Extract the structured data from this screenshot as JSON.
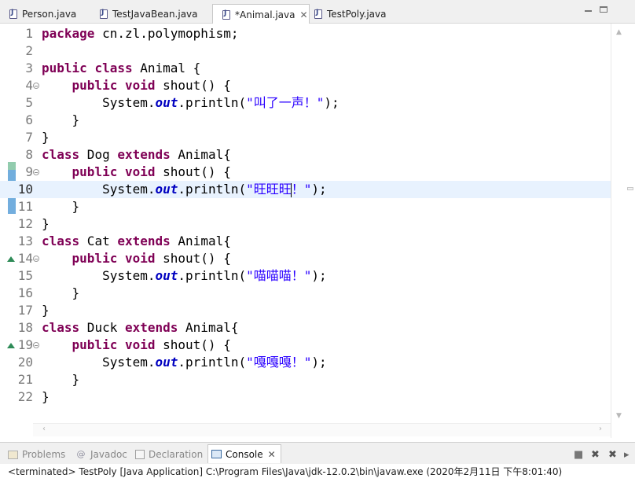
{
  "editor_tabs": [
    {
      "label": "Person.java",
      "active": false
    },
    {
      "label": "TestJavaBean.java",
      "active": false
    },
    {
      "label": "*Animal.java",
      "active": true,
      "close": "✕"
    },
    {
      "label": "TestPoly.java",
      "active": false
    }
  ],
  "code_lines": [
    {
      "num": "1",
      "segments": [
        {
          "t": "package",
          "c": "kw"
        },
        {
          "t": " cn.zl.polymophism;",
          "c": ""
        }
      ]
    },
    {
      "num": "2",
      "segments": []
    },
    {
      "num": "3",
      "segments": [
        {
          "t": "public",
          "c": "kw"
        },
        {
          "t": " ",
          "c": ""
        },
        {
          "t": "class",
          "c": "kw"
        },
        {
          "t": " Animal {",
          "c": ""
        }
      ]
    },
    {
      "num": "4",
      "fold": true,
      "segments": [
        {
          "t": "    ",
          "c": ""
        },
        {
          "t": "public",
          "c": "kw"
        },
        {
          "t": " ",
          "c": ""
        },
        {
          "t": "void",
          "c": "kw"
        },
        {
          "t": " shout() {",
          "c": ""
        }
      ]
    },
    {
      "num": "5",
      "segments": [
        {
          "t": "        System.",
          "c": ""
        },
        {
          "t": "out",
          "c": "fld"
        },
        {
          "t": ".println(",
          "c": ""
        },
        {
          "t": "\"叫了一声！\"",
          "c": "str"
        },
        {
          "t": ");",
          "c": ""
        }
      ]
    },
    {
      "num": "6",
      "segments": [
        {
          "t": "    }",
          "c": ""
        }
      ]
    },
    {
      "num": "7",
      "segments": [
        {
          "t": "}",
          "c": ""
        }
      ]
    },
    {
      "num": "8",
      "segments": [
        {
          "t": "class",
          "c": "kw"
        },
        {
          "t": " Dog ",
          "c": ""
        },
        {
          "t": "extends",
          "c": "kw"
        },
        {
          "t": " Animal{",
          "c": ""
        }
      ]
    },
    {
      "num": "9",
      "fold": true,
      "segments": [
        {
          "t": "    ",
          "c": ""
        },
        {
          "t": "public",
          "c": "kw"
        },
        {
          "t": " ",
          "c": ""
        },
        {
          "t": "void",
          "c": "kw"
        },
        {
          "t": " shout() {",
          "c": ""
        }
      ]
    },
    {
      "num": "10",
      "current": true,
      "segments": [
        {
          "t": "        System.",
          "c": ""
        },
        {
          "t": "out",
          "c": "fld"
        },
        {
          "t": ".println(",
          "c": ""
        },
        {
          "t": "\"旺旺旺",
          "c": "str"
        },
        {
          "caret": true
        },
        {
          "t": "！\"",
          "c": "str"
        },
        {
          "t": ");",
          "c": ""
        }
      ]
    },
    {
      "num": "11",
      "segments": [
        {
          "t": "    }",
          "c": ""
        }
      ]
    },
    {
      "num": "12",
      "segments": [
        {
          "t": "}",
          "c": ""
        }
      ]
    },
    {
      "num": "13",
      "segments": [
        {
          "t": "class",
          "c": "kw"
        },
        {
          "t": " Cat ",
          "c": ""
        },
        {
          "t": "extends",
          "c": "kw"
        },
        {
          "t": " Animal{",
          "c": ""
        }
      ]
    },
    {
      "num": "14",
      "fold": true,
      "override": true,
      "segments": [
        {
          "t": "    ",
          "c": ""
        },
        {
          "t": "public",
          "c": "kw"
        },
        {
          "t": " ",
          "c": ""
        },
        {
          "t": "void",
          "c": "kw"
        },
        {
          "t": " shout() {",
          "c": ""
        }
      ]
    },
    {
      "num": "15",
      "segments": [
        {
          "t": "        System.",
          "c": ""
        },
        {
          "t": "out",
          "c": "fld"
        },
        {
          "t": ".println(",
          "c": ""
        },
        {
          "t": "\"喵喵喵！\"",
          "c": "str"
        },
        {
          "t": ");",
          "c": ""
        }
      ]
    },
    {
      "num": "16",
      "segments": [
        {
          "t": "    }",
          "c": ""
        }
      ]
    },
    {
      "num": "17",
      "segments": [
        {
          "t": "}",
          "c": ""
        }
      ]
    },
    {
      "num": "18",
      "segments": [
        {
          "t": "class",
          "c": "kw"
        },
        {
          "t": " Duck ",
          "c": ""
        },
        {
          "t": "extends",
          "c": "kw"
        },
        {
          "t": " Animal{",
          "c": ""
        }
      ]
    },
    {
      "num": "19",
      "fold": true,
      "override": true,
      "segments": [
        {
          "t": "    ",
          "c": ""
        },
        {
          "t": "public",
          "c": "kw"
        },
        {
          "t": " ",
          "c": ""
        },
        {
          "t": "void",
          "c": "kw"
        },
        {
          "t": " shout() {",
          "c": ""
        }
      ]
    },
    {
      "num": "20",
      "segments": [
        {
          "t": "        System.",
          "c": ""
        },
        {
          "t": "out",
          "c": "fld"
        },
        {
          "t": ".println(",
          "c": ""
        },
        {
          "t": "\"嘎嘎嘎！\"",
          "c": "str"
        },
        {
          "t": ");",
          "c": ""
        }
      ]
    },
    {
      "num": "21",
      "segments": [
        {
          "t": "    }",
          "c": ""
        }
      ]
    },
    {
      "num": "22",
      "segments": [
        {
          "t": "}",
          "c": ""
        }
      ]
    }
  ],
  "console_tabs": {
    "problems": "Problems",
    "javadoc": "Javadoc",
    "declaration": "Declaration",
    "console": "Console",
    "console_close": "✕"
  },
  "console_status": "<terminated> TestPoly [Java Application] C:\\Program Files\\Java\\jdk-12.0.2\\bin\\javaw.exe (2020年2月11日 下午8:01:40)",
  "colors": {
    "keyword": "#7f0055",
    "field": "#0000c0",
    "string": "#2a00ff",
    "current_line": "#e8f2fe"
  }
}
